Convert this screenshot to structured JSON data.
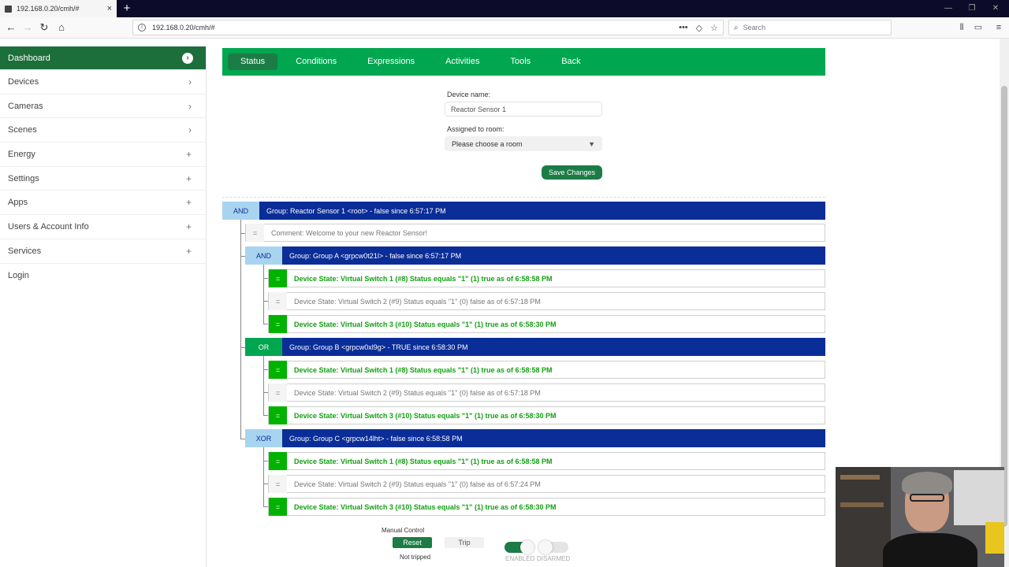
{
  "browser": {
    "tab_title": "192.168.0.20/cmh/#",
    "tab_close": "×",
    "new_tab": "+",
    "url": "192.168.0.20/cmh/#",
    "search_placeholder": "Search",
    "buttons": {
      "back": "←",
      "forward": "→",
      "reload": "↻",
      "home": "⌂"
    },
    "url_actions": {
      "more": "•••",
      "pocket": "◇",
      "bookmark": "☆"
    },
    "window_controls": {
      "minimize": "—",
      "restore": "❐",
      "close": "✕"
    }
  },
  "sidebar": {
    "items": [
      {
        "label": "Dashboard",
        "icon": "›"
      },
      {
        "label": "Devices",
        "icon": "›"
      },
      {
        "label": "Cameras",
        "icon": "›"
      },
      {
        "label": "Scenes",
        "icon": "›"
      },
      {
        "label": "Energy",
        "icon": "+"
      },
      {
        "label": "Settings",
        "icon": "+"
      },
      {
        "label": "Apps",
        "icon": "+"
      },
      {
        "label": "Users & Account Info",
        "icon": "+"
      },
      {
        "label": "Services",
        "icon": "+"
      },
      {
        "label": "Login",
        "icon": ""
      }
    ]
  },
  "tabs": [
    "Status",
    "Conditions",
    "Expressions",
    "Activities",
    "Tools",
    "Back"
  ],
  "form": {
    "device_name_label": "Device name:",
    "device_name_value": "Reactor Sensor 1",
    "room_label": "Assigned to room:",
    "room_value": "Please choose a room",
    "save_label": "Save Changes"
  },
  "tree": {
    "root": {
      "op": "AND",
      "text": "Group: Reactor Sensor 1 <root> - false since 6:57:17 PM"
    },
    "comment": {
      "sym": "=",
      "text": "Comment: Welcome to your new Reactor Sensor!"
    },
    "groups": [
      {
        "op": "AND",
        "true": false,
        "text": "Group: Group A <grpcw0t21l> - false since 6:57:17 PM",
        "conditions": [
          {
            "sym": "=",
            "true": true,
            "text": "Device State: Virtual Switch 1 (#8) Status equals \"1\"   (1) true as of 6:58:58 PM"
          },
          {
            "sym": "=",
            "true": false,
            "text": "Device State: Virtual Switch 2 (#9) Status equals \"1\"   (0) false as of 6:57:18 PM"
          },
          {
            "sym": "=",
            "true": true,
            "text": "Device State: Virtual Switch 3 (#10) Status equals \"1\"   (1) true as of 6:58:30 PM"
          }
        ]
      },
      {
        "op": "OR",
        "true": true,
        "text": "Group: Group B <grpcw0xl9g> - TRUE since 6:58:30 PM",
        "conditions": [
          {
            "sym": "=",
            "true": true,
            "text": "Device State: Virtual Switch 1 (#8) Status equals \"1\"   (1) true as of 6:58:58 PM"
          },
          {
            "sym": "=",
            "true": false,
            "text": "Device State: Virtual Switch 2 (#9) Status equals \"1\"   (0) false as of 6:57:18 PM"
          },
          {
            "sym": "=",
            "true": true,
            "text": "Device State: Virtual Switch 3 (#10) Status equals \"1\"   (1) true as of 6:58:30 PM"
          }
        ]
      },
      {
        "op": "XOR",
        "true": false,
        "text": "Group: Group C <grpcw14lht> - false since 6:58:58 PM",
        "conditions": [
          {
            "sym": "=",
            "true": true,
            "text": "Device State: Virtual Switch 1 (#8) Status equals \"1\"   (1) true as of 6:58:58 PM"
          },
          {
            "sym": "=",
            "true": false,
            "text": "Device State: Virtual Switch 2 (#9) Status equals \"1\"   (0) false as of 6:57:24 PM"
          },
          {
            "sym": "=",
            "true": true,
            "text": "Device State: Virtual Switch 3 (#10) Status equals \"1\"   (1) true as of 6:58:30 PM"
          }
        ]
      }
    ]
  },
  "controls": {
    "manual_label": "Manual Control",
    "reset_label": "Reset",
    "trip_label": "Trip",
    "tripped_status": "Not tripped",
    "enabled_label": "ENABLED",
    "armed_label": "DISARMED",
    "enabled_on": true,
    "armed_on": false
  },
  "colors": {
    "nav_green": "#00a650",
    "sidebar_active": "#1c6e3a",
    "group_blue": "#0a2d97",
    "true_green": "#00b300"
  }
}
